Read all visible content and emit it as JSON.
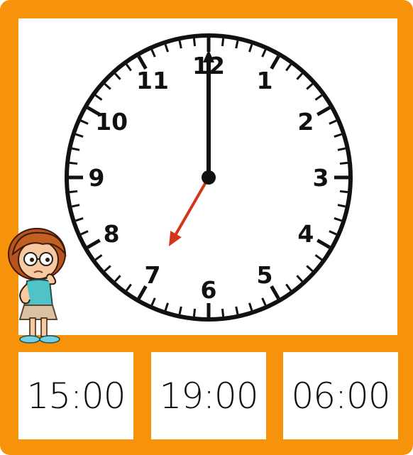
{
  "clock": {
    "numbers": [
      "12",
      "1",
      "2",
      "3",
      "4",
      "5",
      "6",
      "7",
      "8",
      "9",
      "10",
      "11"
    ],
    "hour_value": 7,
    "minute_value": 0,
    "hour_hand_color": "#D4341A",
    "minute_hand_color": "#111111"
  },
  "answers": [
    {
      "label": "15:00"
    },
    {
      "label": "19:00"
    },
    {
      "label": "06:00"
    }
  ],
  "colors": {
    "frame": "#F7930A",
    "panel": "#FFFFFF"
  },
  "character": {
    "icon": "thinking-girl-icon"
  }
}
